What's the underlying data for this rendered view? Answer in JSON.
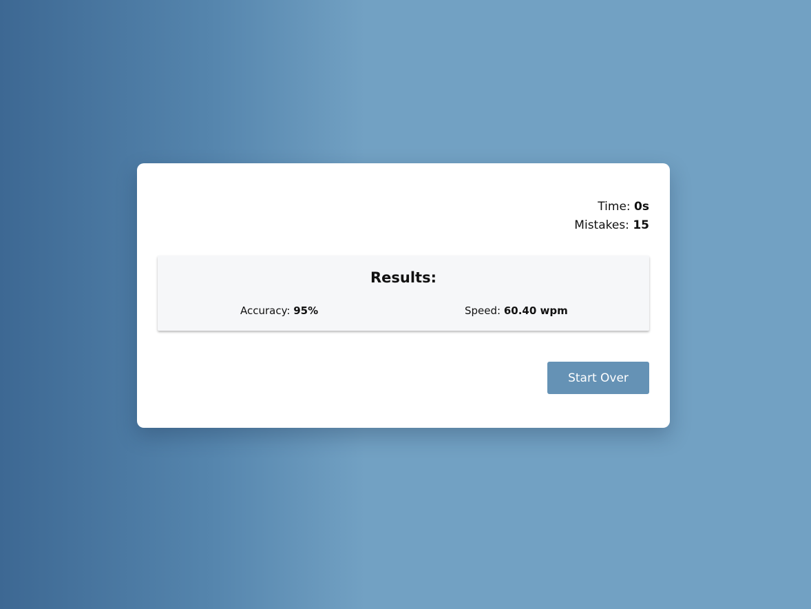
{
  "stats": {
    "time_label": "Time:",
    "time_value": "0s",
    "mistakes_label": "Mistakes:",
    "mistakes_value": "15"
  },
  "results": {
    "title": "Results:",
    "accuracy_label": "Accuracy:",
    "accuracy_value": "95%",
    "speed_label": "Speed:",
    "speed_value": "60.40 wpm"
  },
  "actions": {
    "start_over_label": "Start Over"
  },
  "colors": {
    "background_left": "#3d6893",
    "background_right": "#72a1c3",
    "card": "#ffffff",
    "results_panel": "#f6f7f9",
    "button": "#6592b5"
  }
}
